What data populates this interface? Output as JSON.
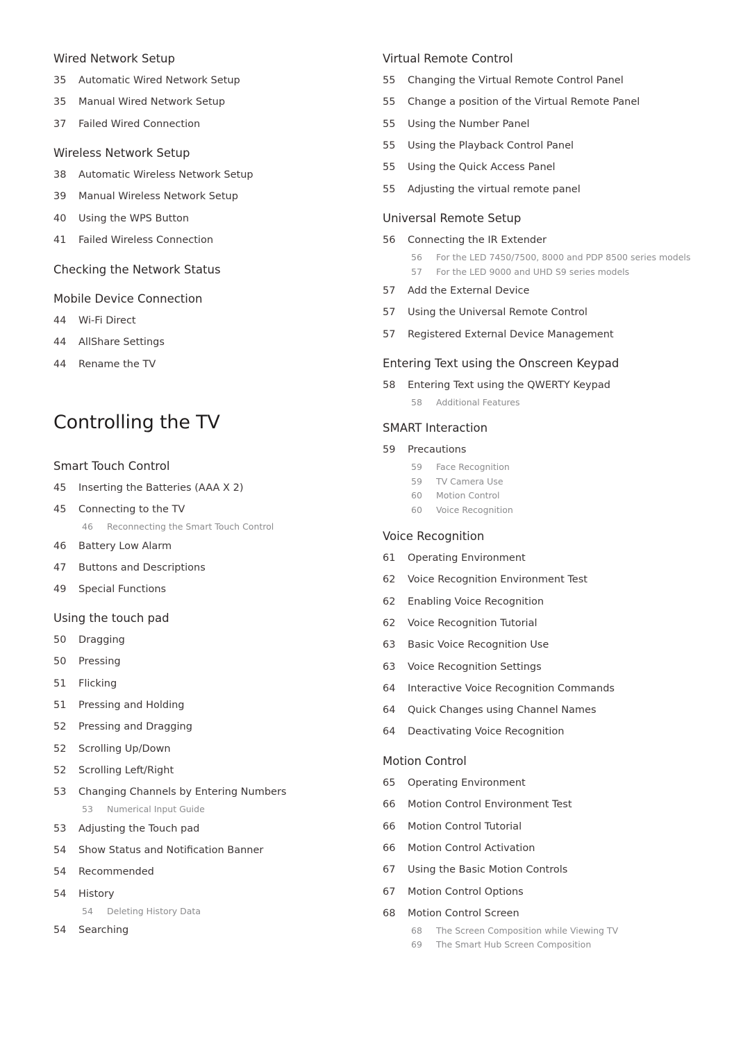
{
  "left_column": {
    "sections": [
      {
        "heading": "Wired Network Setup",
        "items": [
          {
            "page": "35",
            "title": "Automatic Wired Network Setup"
          },
          {
            "page": "35",
            "title": "Manual Wired Network Setup"
          },
          {
            "page": "37",
            "title": "Failed Wired Connection"
          }
        ]
      },
      {
        "heading": "Wireless Network Setup",
        "items": [
          {
            "page": "38",
            "title": "Automatic Wireless Network Setup"
          },
          {
            "page": "39",
            "title": "Manual Wireless Network Setup"
          },
          {
            "page": "40",
            "title": "Using the WPS Button"
          },
          {
            "page": "41",
            "title": "Failed Wireless Connection"
          }
        ]
      },
      {
        "heading": "Checking the Network Status",
        "items": []
      },
      {
        "heading": "Mobile Device Connection",
        "items": [
          {
            "page": "44",
            "title": "Wi-Fi Direct"
          },
          {
            "page": "44",
            "title": "AllShare Settings"
          },
          {
            "page": "44",
            "title": "Rename the TV"
          }
        ]
      }
    ],
    "chapter_title": "Controlling the TV",
    "chapter_sections": [
      {
        "heading": "Smart Touch Control",
        "items": [
          {
            "page": "45",
            "title": "Inserting the Batteries (AAA X 2)"
          },
          {
            "page": "45",
            "title": "Connecting to the TV",
            "subitems": [
              {
                "page": "46",
                "title": "Reconnecting the Smart Touch Control"
              }
            ]
          },
          {
            "page": "46",
            "title": "Battery Low Alarm"
          },
          {
            "page": "47",
            "title": "Buttons and Descriptions"
          },
          {
            "page": "49",
            "title": "Special Functions"
          }
        ]
      },
      {
        "heading": "Using the touch pad",
        "items": [
          {
            "page": "50",
            "title": "Dragging"
          },
          {
            "page": "50",
            "title": "Pressing"
          },
          {
            "page": "51",
            "title": "Flicking"
          },
          {
            "page": "51",
            "title": "Pressing and Holding"
          },
          {
            "page": "52",
            "title": "Pressing and Dragging"
          },
          {
            "page": "52",
            "title": "Scrolling Up/Down"
          },
          {
            "page": "52",
            "title": "Scrolling Left/Right"
          },
          {
            "page": "53",
            "title": "Changing Channels by Entering Numbers",
            "subitems": [
              {
                "page": "53",
                "title": "Numerical Input Guide"
              }
            ]
          },
          {
            "page": "53",
            "title": "Adjusting the Touch pad"
          },
          {
            "page": "54",
            "title": "Show Status and Notification Banner"
          },
          {
            "page": "54",
            "title": "Recommended"
          },
          {
            "page": "54",
            "title": "History",
            "subitems": [
              {
                "page": "54",
                "title": "Deleting History Data"
              }
            ]
          },
          {
            "page": "54",
            "title": "Searching"
          }
        ]
      }
    ]
  },
  "right_column": {
    "sections": [
      {
        "heading": "Virtual Remote Control",
        "items": [
          {
            "page": "55",
            "title": "Changing the Virtual Remote Control Panel"
          },
          {
            "page": "55",
            "title": "Change a position of the Virtual Remote Panel"
          },
          {
            "page": "55",
            "title": "Using the Number Panel"
          },
          {
            "page": "55",
            "title": "Using the Playback Control Panel"
          },
          {
            "page": "55",
            "title": "Using the Quick Access Panel"
          },
          {
            "page": "55",
            "title": "Adjusting the virtual remote panel"
          }
        ]
      },
      {
        "heading": "Universal Remote Setup",
        "items": [
          {
            "page": "56",
            "title": "Connecting the IR Extender",
            "subitems": [
              {
                "page": "56",
                "title": "For the LED 7450/7500, 8000 and PDP 8500 series models"
              },
              {
                "page": "57",
                "title": "For the LED 9000 and UHD S9 series models"
              }
            ]
          },
          {
            "page": "57",
            "title": "Add the External Device"
          },
          {
            "page": "57",
            "title": "Using the Universal Remote Control"
          },
          {
            "page": "57",
            "title": "Registered External Device Management"
          }
        ]
      },
      {
        "heading": "Entering Text using the Onscreen Keypad",
        "items": [
          {
            "page": "58",
            "title": "Entering Text using the QWERTY Keypad",
            "subitems": [
              {
                "page": "58",
                "title": "Additional Features"
              }
            ]
          }
        ]
      },
      {
        "heading": "SMART Interaction",
        "items": [
          {
            "page": "59",
            "title": "Precautions",
            "subitems": [
              {
                "page": "59",
                "title": "Face Recognition"
              },
              {
                "page": "59",
                "title": "TV Camera Use"
              },
              {
                "page": "60",
                "title": "Motion Control"
              },
              {
                "page": "60",
                "title": "Voice Recognition"
              }
            ]
          }
        ]
      },
      {
        "heading": "Voice Recognition",
        "items": [
          {
            "page": "61",
            "title": "Operating Environment"
          },
          {
            "page": "62",
            "title": "Voice Recognition Environment Test"
          },
          {
            "page": "62",
            "title": "Enabling Voice Recognition"
          },
          {
            "page": "62",
            "title": "Voice Recognition Tutorial"
          },
          {
            "page": "63",
            "title": "Basic Voice Recognition Use"
          },
          {
            "page": "63",
            "title": "Voice Recognition Settings"
          },
          {
            "page": "64",
            "title": "Interactive Voice Recognition Commands"
          },
          {
            "page": "64",
            "title": "Quick Changes using Channel Names"
          },
          {
            "page": "64",
            "title": "Deactivating Voice Recognition"
          }
        ]
      },
      {
        "heading": "Motion Control",
        "items": [
          {
            "page": "65",
            "title": "Operating Environment"
          },
          {
            "page": "66",
            "title": "Motion Control Environment Test"
          },
          {
            "page": "66",
            "title": "Motion Control Tutorial"
          },
          {
            "page": "66",
            "title": "Motion Control Activation"
          },
          {
            "page": "67",
            "title": "Using the Basic Motion Controls"
          },
          {
            "page": "67",
            "title": "Motion Control Options"
          },
          {
            "page": "68",
            "title": "Motion Control Screen",
            "subitems": [
              {
                "page": "68",
                "title": "The Screen Composition while Viewing TV"
              },
              {
                "page": "69",
                "title": "The Smart Hub Screen Composition"
              }
            ]
          }
        ]
      }
    ]
  }
}
